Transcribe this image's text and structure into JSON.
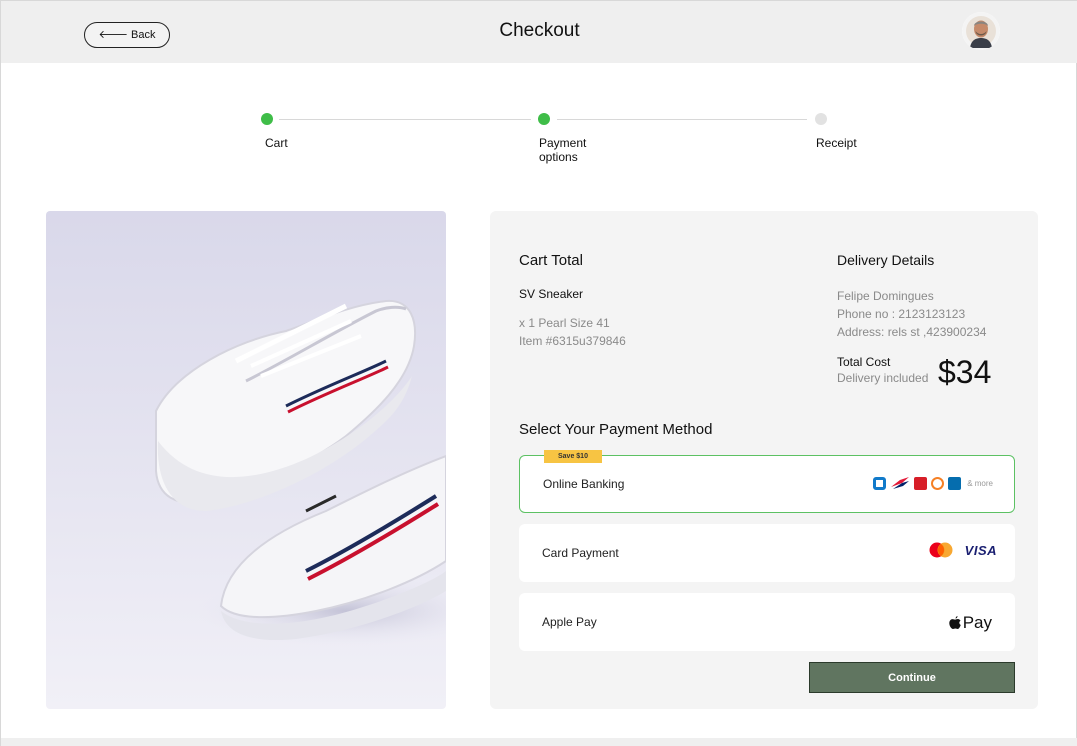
{
  "header": {
    "back_label": "Back",
    "title": "Checkout"
  },
  "stepper": {
    "steps": [
      {
        "label": "Cart",
        "status": "complete"
      },
      {
        "label": "Payment\noptions",
        "status": "complete"
      },
      {
        "label": "Receipt",
        "status": "pending"
      }
    ]
  },
  "cart": {
    "title": "Cart Total",
    "item_name": "SV Sneaker",
    "item_variant": "x 1 Pearl Size 41",
    "item_sku": "Item #6315u379846"
  },
  "delivery": {
    "title": "Delivery Details",
    "name": "Felipe Domingues",
    "phone": "Phone no : 2123123123",
    "address": "Address: rels st ,423900234",
    "total_label": "Total Cost",
    "total_sub": "Delivery included",
    "total_amount": "$34"
  },
  "payment": {
    "title": "Select Your Payment Method",
    "options": [
      {
        "label": "Online Banking",
        "badge": "Save $10",
        "selected": true,
        "more_text": "& more"
      },
      {
        "label": "Card Payment",
        "selected": false,
        "visa_text": "VISA"
      },
      {
        "label": "Apple Pay",
        "selected": false,
        "pay_text": "Pay"
      }
    ],
    "continue_label": "Continue"
  },
  "colors": {
    "step_complete": "#3fbd48",
    "selected_border": "#5cc163",
    "badge": "#f7c443",
    "continue_bg": "#607560"
  },
  "icons": [
    "arrow-left-icon",
    "user-avatar",
    "bank-logos",
    "mastercard-icon",
    "visa-icon",
    "apple-pay-icon"
  ]
}
